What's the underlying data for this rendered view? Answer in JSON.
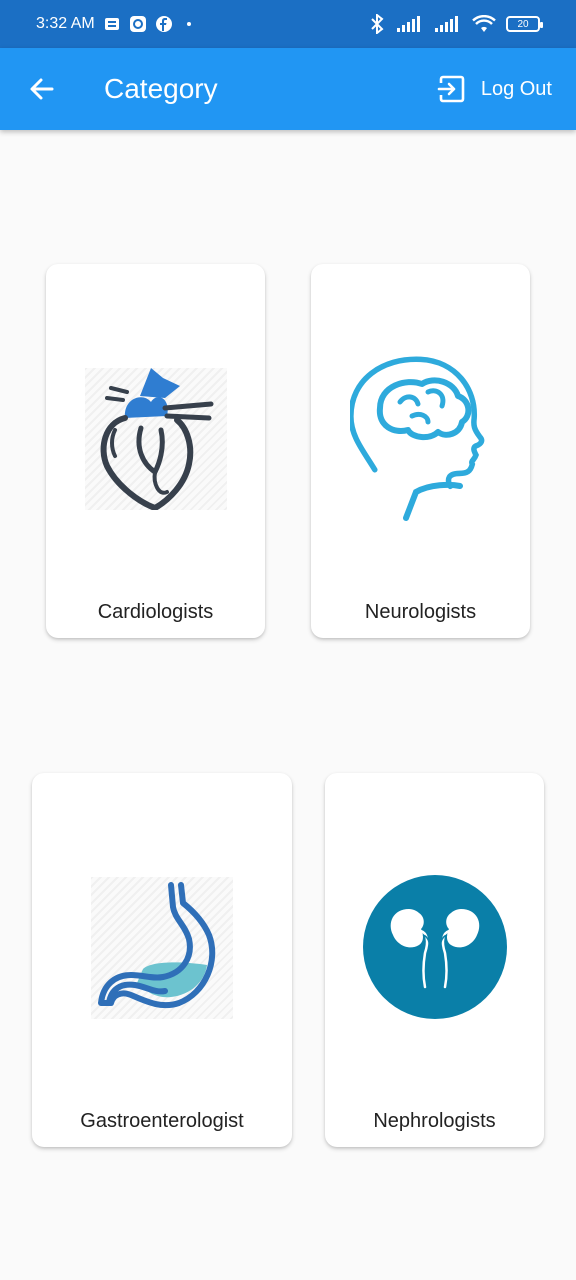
{
  "status_bar": {
    "time": "3:32 AM",
    "battery": "20"
  },
  "app_bar": {
    "title": "Category",
    "logout_label": "Log Out"
  },
  "categories": [
    {
      "label": "Cardiologists"
    },
    {
      "label": "Neurologists"
    },
    {
      "label": "Gastroenterologist"
    },
    {
      "label": "Nephrologists"
    }
  ],
  "colors": {
    "status_bar": "#1b6fc4",
    "app_bar": "#2196f3",
    "background": "#fafafa",
    "kidney_circle": "#0a7fa8"
  }
}
